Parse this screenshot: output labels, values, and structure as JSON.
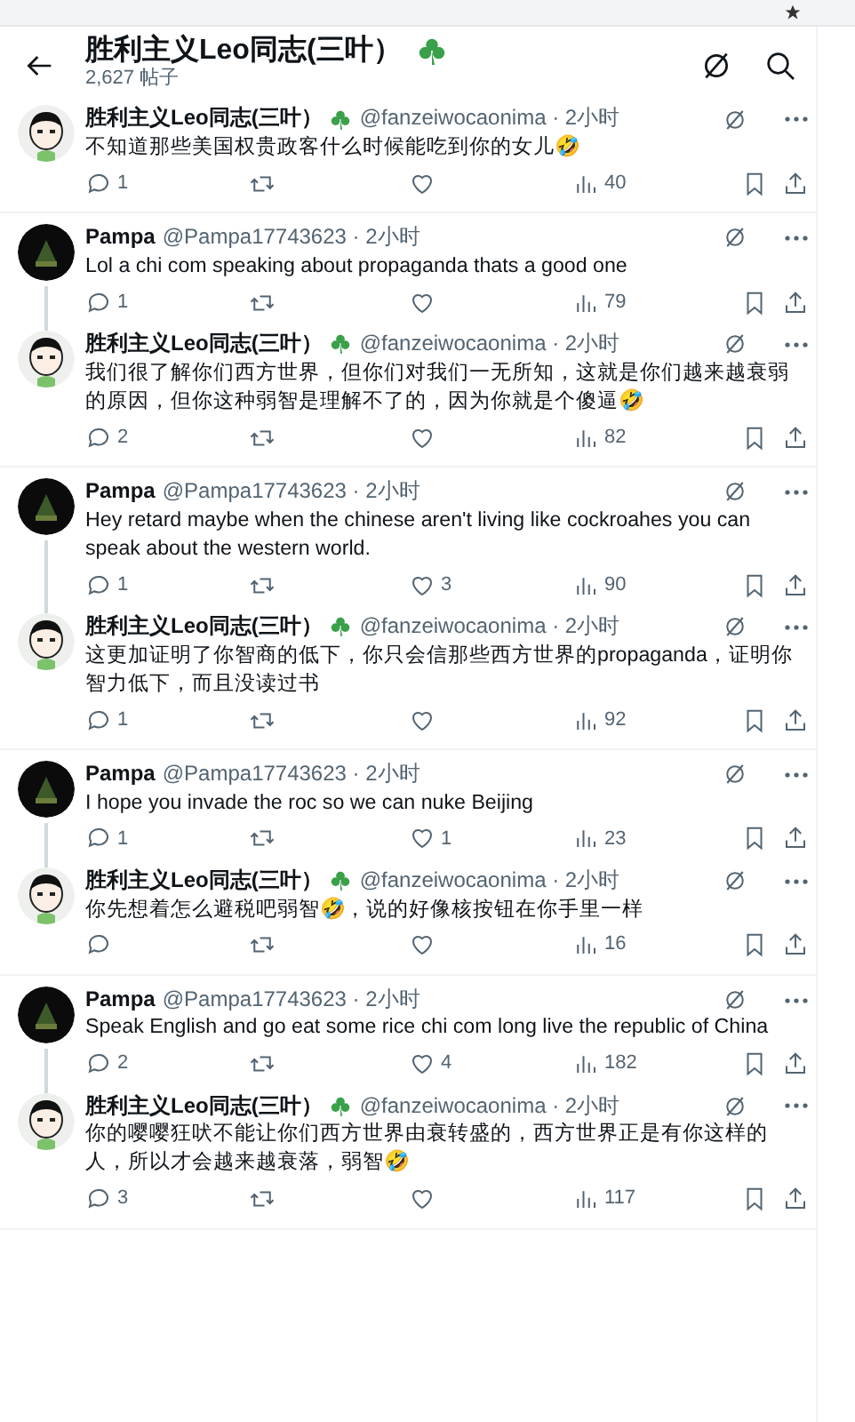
{
  "header": {
    "title": "胜利主义Leo同志(三叶）",
    "post_count": "2,627 帖子"
  },
  "threads": [
    {
      "posts": [
        {
          "kind": "cartoon",
          "name": "胜利主义Leo同志(三叶）",
          "clover": true,
          "meta": "@fanzeiwocaonima · 2小时",
          "body": "不知道那些美国权贵政客什么时候能吃到你的女儿🤣",
          "replies": "1",
          "views": "40"
        }
      ]
    },
    {
      "posts": [
        {
          "kind": "dark",
          "name": "Pampa",
          "meta": "@Pampa17743623 · 2小时",
          "body": "Lol a chi com speaking about propaganda thats a good one",
          "replies": "1",
          "views": "79"
        },
        {
          "kind": "cartoon",
          "name": "胜利主义Leo同志(三叶）",
          "clover": true,
          "meta": "@fanzeiwocaonima · 2小时",
          "body": "我们很了解你们西方世界，但你们对我们一无所知，这就是你们越来越衰弱的原因，但你这种弱智是理解不了的，因为你就是个傻逼🤣",
          "replies": "2",
          "views": "82"
        }
      ]
    },
    {
      "posts": [
        {
          "kind": "dark",
          "name": "Pampa",
          "meta": "@Pampa17743623 · 2小时",
          "body": "Hey retard maybe when the chinese aren't living like cockroahes you can speak about the western world.",
          "replies": "1",
          "likes": "3",
          "views": "90"
        },
        {
          "kind": "cartoon",
          "name": "胜利主义Leo同志(三叶）",
          "clover": true,
          "meta": "@fanzeiwocaonima · 2小时",
          "body": "这更加证明了你智商的低下，你只会信那些西方世界的propaganda，证明你智力低下，而且没读过书",
          "replies": "1",
          "views": "92"
        }
      ]
    },
    {
      "posts": [
        {
          "kind": "dark",
          "name": "Pampa",
          "meta": "@Pampa17743623 · 2小时",
          "body": "I hope you invade the roc so we can nuke Beijing",
          "replies": "1",
          "likes": "1",
          "views": "23"
        },
        {
          "kind": "cartoon",
          "name": "胜利主义Leo同志(三叶）",
          "clover": true,
          "meta": "@fanzeiwocaonima · 2小时",
          "body": "你先想着怎么避税吧弱智🤣，说的好像核按钮在你手里一样",
          "views": "16"
        }
      ]
    },
    {
      "posts": [
        {
          "kind": "dark",
          "name": "Pampa",
          "meta": "@Pampa17743623 · 2小时",
          "body": "Speak English and go eat some rice chi com long live the republic of China",
          "replies": "2",
          "likes": "4",
          "views": "182"
        },
        {
          "kind": "cartoon",
          "name": "胜利主义Leo同志(三叶）",
          "clover": true,
          "meta": "@fanzeiwocaonima · 2小时",
          "body": "你的嘤嘤狂吠不能让你们西方世界由衰转盛的，西方世界正是有你这样的人，所以才会越来越衰落，弱智🤣",
          "replies": "3",
          "views": "117"
        }
      ]
    }
  ]
}
